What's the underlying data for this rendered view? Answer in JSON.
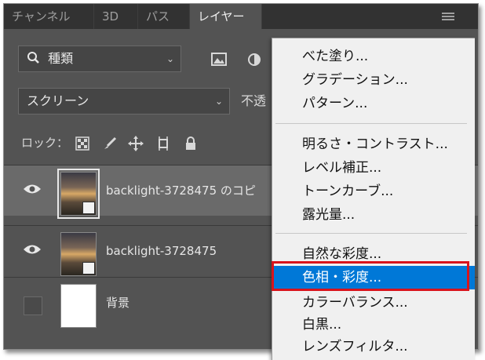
{
  "tabs": [
    {
      "label": "チャンネル",
      "active": false
    },
    {
      "label": "3D",
      "active": false
    },
    {
      "label": "パス",
      "active": false
    },
    {
      "label": "レイヤー",
      "active": true
    }
  ],
  "filter": {
    "label": "種類"
  },
  "blend_mode": {
    "value": "スクリーン"
  },
  "opacity": {
    "label": "不透"
  },
  "lock": {
    "label": "ロック："
  },
  "layers": [
    {
      "name": "backlight-3728475 のコピ",
      "visible": true,
      "selected": true,
      "thumbnail": "photo"
    },
    {
      "name": "backlight-3728475",
      "visible": true,
      "selected": false,
      "thumbnail": "photo"
    },
    {
      "name": "背景",
      "visible": false,
      "selected": false,
      "thumbnail": "white"
    }
  ],
  "menu": {
    "items": [
      {
        "label": "べた塗り...",
        "group": 1
      },
      {
        "label": "グラデーション...",
        "group": 1
      },
      {
        "label": "パターン...",
        "group": 1
      },
      {
        "label": "明るさ・コントラスト...",
        "group": 2
      },
      {
        "label": "レベル補正...",
        "group": 2
      },
      {
        "label": "トーンカーブ...",
        "group": 2
      },
      {
        "label": "露光量...",
        "group": 2
      },
      {
        "label": "自然な彩度...",
        "group": 3
      },
      {
        "label": "色相・彩度...",
        "group": 3,
        "highlighted": true
      },
      {
        "label": "カラーバランス...",
        "group": 3
      },
      {
        "label": "白黒...",
        "group": 3
      },
      {
        "label": "レンズフィルタ...",
        "group": 3
      }
    ]
  },
  "colors": {
    "highlight": "#0078d7",
    "annotation": "#d9141c",
    "panel": "#535353"
  }
}
